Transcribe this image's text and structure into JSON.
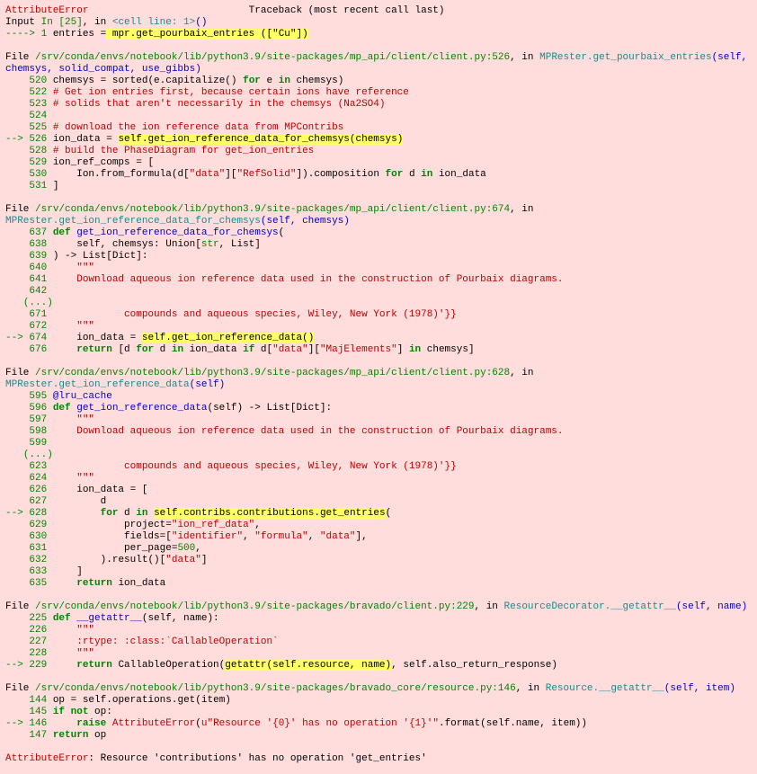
{
  "tb": {
    "header_error": "AttributeError",
    "header_space": "                           ",
    "header_rest": "Traceback (most recent call last)",
    "input_prefix": "Input ",
    "input_in": "In [25]",
    "input_in_rest": ", in ",
    "input_cell": "<cell line: 1>",
    "input_paren": "()",
    "arrow_1": "----> 1",
    "l1a": " entries ",
    "l1eq": "=",
    "l1b": " mpr",
    "l1dot1": ".",
    "l1c": "get_pourbaix_entries ([",
    "l1q": "\"Cu\"",
    "l1end": "])",
    "f1_file": "File ",
    "f1_path": "/srv/conda/envs/notebook/lib/python3.9/site-packages/mp_api/client/client.py:526",
    "f1_in": ", in ",
    "f1_func": "MPRester.get_pourbaix_entries",
    "f1_args": "(self, chemsys, solid_compat, use_gibbs)",
    "f1_520a": "    520",
    "f1_520b": " chemsys ",
    "f1_520eq": "=",
    "f1_520c": " sorted(e",
    "f1_520dot": ".",
    "f1_520d": "capitalize() ",
    "f1_520for": "for",
    "f1_520e": " e ",
    "f1_520in": "in",
    "f1_520f": " chemsys)",
    "f1_522": "    522",
    "f1_522c": " # Get ion entries first, because certain ions have reference",
    "f1_523": "    523",
    "f1_523c": " # solids that aren't necessarily in the chemsys (Na2SO4)",
    "f1_524": "    524",
    "f1_525": "    525",
    "f1_525c": " # download the ion reference data from MPContribs",
    "f1_526arrow": "--> 526",
    "f1_526a": " ion_data ",
    "f1_526eq": "=",
    "f1_526sp": " ",
    "f1_526self": "self",
    "f1_526dot": ".",
    "f1_526fn": "get_ion_reference_data_for_chemsys(chemsys)",
    "f1_528": "    528",
    "f1_528c": " # build the PhaseDiagram for get_ion_entries",
    "f1_529": "    529",
    "f1_529a": " ion_ref_comps ",
    "f1_529eq": "=",
    "f1_529b": " [",
    "f1_530": "    530",
    "f1_530a": "     Ion",
    "f1_530dot": ".",
    "f1_530b": "from_formula(d[",
    "f1_530q1": "\"data\"",
    "f1_530c": "][",
    "f1_530q2": "\"RefSolid\"",
    "f1_530d": "])",
    "f1_530dot2": ".",
    "f1_530e": "composition ",
    "f1_530for": "for",
    "f1_530f": " d ",
    "f1_530in": "in",
    "f1_530g": " ion_data",
    "f1_531": "    531",
    "f1_531a": " ]",
    "f2_file": "File ",
    "f2_path": "/srv/conda/envs/notebook/lib/python3.9/site-packages/mp_api/client/client.py:674",
    "f2_in": ", in ",
    "f2_func": "MPRester.get_ion_reference_data_for_chemsys",
    "f2_args": "(self, chemsys)",
    "f2_637": "    637",
    "f2_637def": " def",
    "f2_637fn": " get_ion_reference_data_for_chemsys",
    "f2_637p": "(",
    "f2_638": "    638",
    "f2_638a": "     self, chemsys: Union[",
    "f2_638str": "str",
    "f2_638b": ", List]",
    "f2_639": "    639",
    "f2_639a": " ) ",
    "f2_639arrow": "->",
    "f2_639b": " List[Dict]:",
    "f2_640": "    640",
    "f2_640q": "     \"\"\"",
    "f2_641": "    641",
    "f2_641t": "     Download aqueous ion reference data used in the construction of Pourbaix diagrams.",
    "f2_642": "    642",
    "f2_dots": "   (...)",
    "f2_671": "    671",
    "f2_671t": "             compounds and aqueous species, Wiley, New York (1978)'}}",
    "f2_672": "    672",
    "f2_672q": "     \"\"\"",
    "f2_674arrow": "--> 674",
    "f2_674a": "     ion_data ",
    "f2_674eq": "=",
    "f2_674sp": " ",
    "f2_674self": "self",
    "f2_674dot": ".",
    "f2_674fn": "get_ion_reference_data()",
    "f2_676": "    676",
    "f2_676ret": "     return",
    "f2_676a": " [d ",
    "f2_676for": "for",
    "f2_676b": " d ",
    "f2_676in": "in",
    "f2_676c": " ion_data ",
    "f2_676if": "if",
    "f2_676d": " d[",
    "f2_676q1": "\"data\"",
    "f2_676e": "][",
    "f2_676q2": "\"MajElements\"",
    "f2_676f": "] ",
    "f2_676in2": "in",
    "f2_676g": " chemsys]",
    "f3_file": "File ",
    "f3_path": "/srv/conda/envs/notebook/lib/python3.9/site-packages/mp_api/client/client.py:628",
    "f3_in": ", in ",
    "f3_func": "MPRester.get_ion_reference_data",
    "f3_args": "(self)",
    "f3_595": "    595",
    "f3_595d": " @lru_cache",
    "f3_596": "    596",
    "f3_596def": " def",
    "f3_596fn": " get_ion_reference_data",
    "f3_596p": "(",
    "f3_596self": "self",
    "f3_596r": ") ",
    "f3_596arrow": "->",
    "f3_596r2": " List[Dict]:",
    "f3_597": "    597",
    "f3_597q": "     \"\"\"",
    "f3_598": "    598",
    "f3_598t": "     Download aqueous ion reference data used in the construction of Pourbaix diagrams.",
    "f3_599": "    599",
    "f3_dots": "   (...)",
    "f3_623": "    623",
    "f3_623t": "             compounds and aqueous species, Wiley, New York (1978)'}}",
    "f3_624": "    624",
    "f3_624q": "     \"\"\"",
    "f3_626": "    626",
    "f3_626a": "     ion_data ",
    "f3_626eq": "=",
    "f3_626b": " [",
    "f3_627": "    627",
    "f3_627a": "         d",
    "f3_628arrow": "--> 628",
    "f3_628a": "         ",
    "f3_628for": "for",
    "f3_628b": " d ",
    "f3_628in": "in",
    "f3_628sp": " ",
    "f3_628self": "self",
    "f3_628d1": ".",
    "f3_628c1": "contribs",
    "f3_628d2": ".",
    "f3_628c2": "contributions",
    "f3_628d3": ".",
    "f3_628c3": "get_entries",
    "f3_628p": "(",
    "f3_629": "    629",
    "f3_629a": "             project",
    "f3_629eq": "=",
    "f3_629q": "\"ion_ref_data\"",
    "f3_629c": ",",
    "f3_630": "    630",
    "f3_630a": "             fields",
    "f3_630eq": "=",
    "f3_630b": "[",
    "f3_630q1": "\"identifier\"",
    "f3_630c1": ", ",
    "f3_630q2": "\"formula\"",
    "f3_630c2": ", ",
    "f3_630q3": "\"data\"",
    "f3_630end": "],",
    "f3_631": "    631",
    "f3_631a": "             per_page",
    "f3_631eq": "=",
    "f3_631n": "500",
    "f3_631c": ",",
    "f3_632": "    632",
    "f3_632a": "         )",
    "f3_632dot": ".",
    "f3_632b": "result()[",
    "f3_632q": "\"data\"",
    "f3_632end": "]",
    "f3_633": "    633",
    "f3_633a": "     ]",
    "f3_635": "    635",
    "f3_635ret": "     return",
    "f3_635a": " ion_data",
    "f4_file": "File ",
    "f4_path": "/srv/conda/envs/notebook/lib/python3.9/site-packages/bravado/client.py:229",
    "f4_in": ", in ",
    "f4_func": "ResourceDecorator.__getattr__",
    "f4_args": "(self, name)",
    "f4_225": "    225",
    "f4_225def": " def",
    "f4_225fn": " __getattr__",
    "f4_225a": "(self, name):",
    "f4_226": "    226",
    "f4_226q": "     \"\"\"",
    "f4_227": "    227",
    "f4_227t": "     :rtype: :class:`CallableOperation`",
    "f4_228": "    228",
    "f4_228q": "     \"\"\"",
    "f4_229arrow": "--> 229",
    "f4_229ret": "     return",
    "f4_229a": " CallableOperation(",
    "f4_229g": "getattr",
    "f4_229p": "(",
    "f4_229self": "self",
    "f4_229d1": ".",
    "f4_229r": "resource, name)",
    "f4_229c": ", self",
    "f4_229d2": ".",
    "f4_229e": "also_return_response)",
    "f5_file": "File ",
    "f5_path": "/srv/conda/envs/notebook/lib/python3.9/site-packages/bravado_core/resource.py:146",
    "f5_in": ", in ",
    "f5_func": "Resource.__getattr__",
    "f5_args": "(self, item)",
    "f5_144": "    144",
    "f5_144a": " op ",
    "f5_144eq": "=",
    "f5_144b": " self",
    "f5_144dot": ".",
    "f5_144c": "operations",
    "f5_144dot2": ".",
    "f5_144d": "get(item)",
    "f5_145": "    145",
    "f5_145if": " if",
    "f5_145not": " not",
    "f5_145a": " op:",
    "f5_146arrow": "--> 146",
    "f5_146raise": "     raise",
    "f5_146sp": " ",
    "f5_146err": "AttributeError",
    "f5_146a": "(",
    "f5_146u": "u\"Resource '",
    "f5_146b1": "{0}",
    "f5_146b2": "' has no operation '",
    "f5_146b3": "{1}",
    "f5_146b4": "'\"",
    "f5_146dot": ".",
    "f5_146fmt": "format(self",
    "f5_146dot2": ".",
    "f5_146c": "name, item))",
    "f5_147": "    147",
    "f5_147ret": " return",
    "f5_147a": " op",
    "final_err": "AttributeError",
    "final_msg": ": Resource 'contributions' has no operation 'get_entries'"
  }
}
